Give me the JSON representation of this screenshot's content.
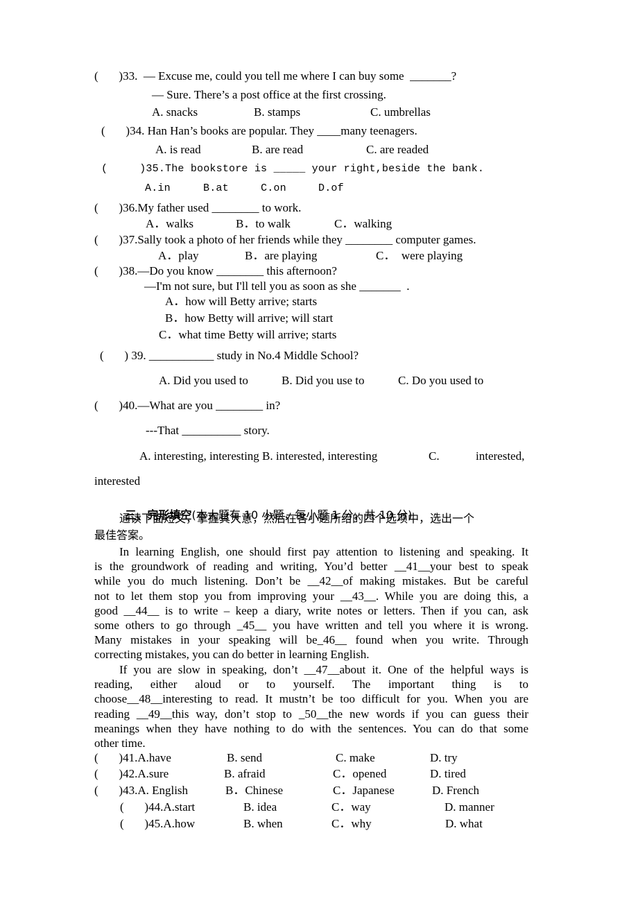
{
  "questions": {
    "q33": {
      "line1": "(       )33.  — Excuse me, could you tell me where I can buy some  _______?",
      "line2": "— Sure. There’s a post office at the first crossing.",
      "options": [
        "A. snacks",
        "B. stamps",
        "C. umbrellas"
      ]
    },
    "q34": {
      "line1": "(       )34. Han Han’s books are popular. They ____many teenagers.",
      "options": [
        "A. is read",
        "B. are read",
        "C. are readed"
      ]
    },
    "q35": {
      "line1": "(     )35.The bookstore is _____ your right,beside the bank.",
      "options": [
        "A.in",
        "B.at",
        "C.on",
        "D.of"
      ]
    },
    "q36": {
      "line1": "(       )36.My father used ________ to work.",
      "options": [
        "A．walks",
        "B．to walk",
        "C．walking"
      ]
    },
    "q37": {
      "line1": "(       )37.Sally took a photo of her friends while they ________ computer games.",
      "options": [
        "A．play",
        "B．are playing",
        "C．  were playing"
      ]
    },
    "q38": {
      "line1": "(       )38.—Do you know ________ this afternoon?",
      "line2": "—I'm not sure, but I'll tell you as soon as she _______  .",
      "options": [
        "A．how will Betty arrive; starts",
        "B．how Betty will arrive; will start",
        "C．what time Betty will arrive; starts"
      ]
    },
    "q39": {
      "line1": "(       ) 39. ___________ study in No.4 Middle School?",
      "options": [
        "A. Did you used to",
        "B. Did you use to",
        "C. Do you used to"
      ]
    },
    "q40": {
      "line1": "(       )40.—What are you ________ in?",
      "line2": "---That __________ story.",
      "options_line": "A. interesting, interesting B. interested, interesting",
      "option_c_label": "C.",
      "option_c_text_part1": "interested,",
      "option_c_text_part2": "interested"
    }
  },
  "section3": {
    "heading_bold": "三、完形填空",
    "heading_rest": "(本大题有 10 小题，每小题 1 分，共 10 分)",
    "instruction_line1": "通读下面短文，掌握其大意，然后在各小题所给的四个选项中，选出一个",
    "instruction_line2": "最佳答案。",
    "passage_p1": [
      "In learning English, one should first pay attention to listening and speaking. It",
      "is the groundwork of reading and writing, You’d better __41__your best to speak",
      "while you do much listening. Don’t be __42__of making mistakes. But be careful",
      "not to let them stop you from improving your __43__. While you are doing this, a",
      "good __44__ is to write – keep a diary, write notes or letters. Then if you can, ask",
      "some others to go through  _45__ you have written and tell you where it is wrong.",
      "Many mistakes in your speaking will be_46__ found when you write. Through",
      "correcting mistakes, you can do better in learning English."
    ],
    "passage_p2": [
      "If you are slow in speaking, don’t __47__about it. One of the helpful ways is",
      "reading, either aloud or to yourself. The important thing is to",
      "choose__48__interesting to read. It mustn’t be too difficult for you. When you are",
      "reading __49__this way, don’t stop to _50__the new words if you can guess their",
      "meanings when they have nothing to do with the sentences. You can do that some",
      "other time."
    ],
    "answers": [
      {
        "prefix": "(       )41.A.have",
        "b": "B. send",
        "c": "C. make",
        "d": "D. try"
      },
      {
        "prefix": "(       )42.A.sure",
        "b": "B. afraid",
        "c": "C．opened",
        "d": "D. tired"
      },
      {
        "prefix": "(       )43.A. English",
        "b": "B．Chinese",
        "c": "C．Japanese",
        "d": "D. French"
      },
      {
        "prefix": "(       )44.A.start",
        "b": "B. idea",
        "c": "C．way",
        "d": "D. manner"
      },
      {
        "prefix": "(       )45.A.how",
        "b": "B. when",
        "c": "C．why",
        "d": "D. what"
      }
    ]
  }
}
